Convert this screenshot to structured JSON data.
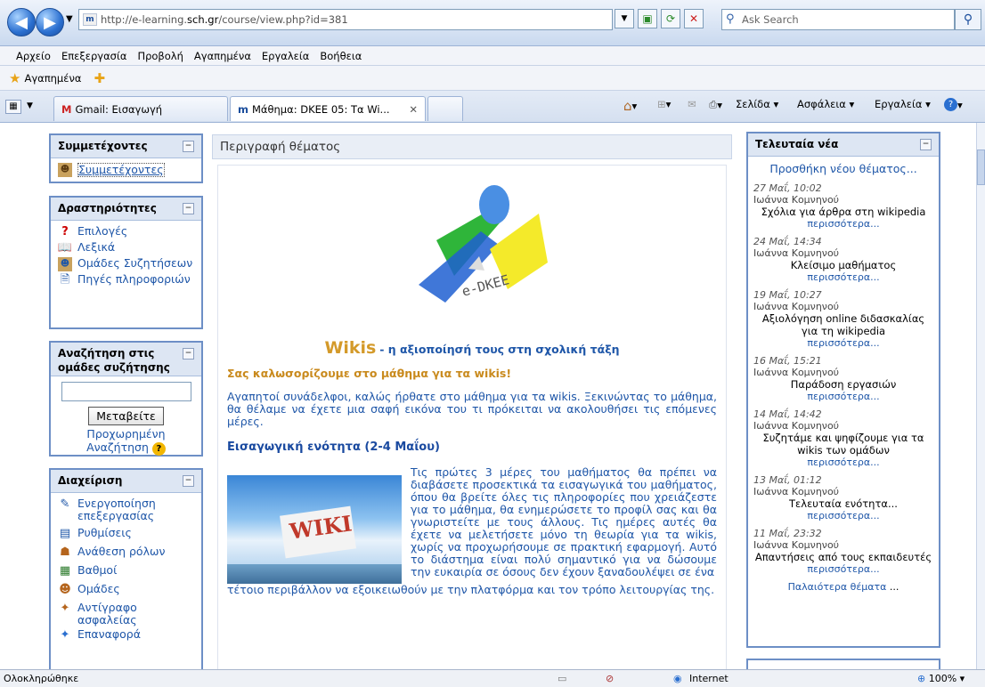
{
  "browser": {
    "url_prefix": "http://e-learning.",
    "url_domain": "sch.gr",
    "url_path": "/course/view.php?id=381",
    "search_placeholder": "Ask Search",
    "favicon_text": "m"
  },
  "menu": [
    "Αρχείο",
    "Επεξεργασία",
    "Προβολή",
    "Αγαπημένα",
    "Εργαλεία",
    "Βοήθεια"
  ],
  "favorites_label": "Αγαπημένα",
  "tabs": [
    {
      "label": "Gmail: Εισαγωγή"
    },
    {
      "label": "Μάθημα: DKEE 05: Τα Wi..."
    }
  ],
  "commands": {
    "page": "Σελίδα",
    "safety": "Ασφάλεια",
    "tools": "Εργαλεία"
  },
  "participants": {
    "title": "Συμμετέχοντες",
    "link": "Συμμετέχοντες"
  },
  "activities": {
    "title": "Δραστηριότητες",
    "items": [
      "Επιλογές",
      "Λεξικά",
      "Ομάδες Συζητήσεων",
      "Πηγές πληροφοριών"
    ]
  },
  "forum_search": {
    "title": "Αναζήτηση στις ομάδες συζήτησης",
    "button": "Μεταβείτε",
    "advanced": "Προχωρημένη Αναζήτηση"
  },
  "admin": {
    "title": "Διαχείριση",
    "items": [
      "Ενεργοποίηση επεξεργασίας",
      "Ρυθμίσεις",
      "Ανάθεση ρόλων",
      "Βαθμοί",
      "Ομάδες",
      "Αντίγραφο ασφαλείας",
      "Επαναφορά"
    ]
  },
  "main": {
    "header": "Περιγραφή θέματος",
    "logo_text": "e-DKEE",
    "wikis_word": "Wikis",
    "wikis_subtitle": "- η αξιοποίησή τους στη σχολική τάξη",
    "welcome": "Σας καλωσορίζουμε στο μάθημα για τα wikis!",
    "intro": "Αγαπητοί συνάδελφοι, καλώς ήρθατε στο μάθημα για τα wikis. Ξεκινώντας το μάθημα, θα θέλαμε να έχετε μια σαφή εικόνα του τι πρόκειται να ακολουθήσει τις επόμενες μέρες.",
    "section": "Εισαγωγική ενότητα (2-4 Μαΐου)",
    "wiki_image_text": "WIKI",
    "paragraph": "Τις πρώτες 3 μέρες του μαθήματος θα πρέπει να διαβάσετε προσεκτικά τα εισαγωγικά του μαθήματος, όπου θα βρείτε όλες τις πληροφορίες που χρειάζεστε για το μάθημα, θα ενημερώσετε το προφίλ σας και θα γνωριστείτε με τους άλλους. Τις ημέρες αυτές θα έχετε να μελετήσετε μόνο τη θεωρία για τα wikis, χωρίς να προχωρήσουμε σε πρακτική εφαρμογή. Αυτό το διάστημα είναι πολύ σημαντικό για να δώσουμε την ευκαιρία σε όσους δεν έχουν ξαναδουλέψει σε ένα",
    "paragraph_cont": "τέτοιο περιβάλλον να εξοικειωθούν με την πλατφόρμα και τον τρόπο λειτουργίας της."
  },
  "news": {
    "title": "Τελευταία νέα",
    "add_topic": "Προσθήκη νέου θέματος...",
    "more_label": "περισσότερα...",
    "older": "Παλαιότερα θέματα",
    "older_suffix": "...",
    "entries": [
      {
        "date": "27 Μαΐ, 10:02",
        "author": "Ιωάννα Κομνηνού",
        "subject": "Σχόλια για άρθρα στη wikipedia"
      },
      {
        "date": "24 Μαΐ, 14:34",
        "author": "Ιωάννα Κομνηνού",
        "subject": "Κλείσιμο μαθήματος"
      },
      {
        "date": "19 Μαΐ, 10:27",
        "author": "Ιωάννα Κομνηνού",
        "subject": "Αξιολόγηση online διδασκαλίας για τη wikipedia"
      },
      {
        "date": "16 Μαΐ, 15:21",
        "author": "Ιωάννα Κομνηνού",
        "subject": "Παράδοση εργασιών"
      },
      {
        "date": "14 Μαΐ, 14:42",
        "author": "Ιωάννα Κομνηνού",
        "subject": "Συζητάμε και ψηφίζουμε για τα wikis των ομάδων"
      },
      {
        "date": "13 Μαΐ, 01:12",
        "author": "Ιωάννα Κομνηνού",
        "subject": "Τελευταία ενότητα..."
      },
      {
        "date": "11 Μαΐ, 23:32",
        "author": "Ιωάννα Κομνηνού",
        "subject": "Απαντήσεις από τους εκπαιδευτές"
      }
    ]
  },
  "status": {
    "left": "Ολοκληρώθηκε",
    "zone": "Internet",
    "zoom": "100%"
  },
  "colors": {
    "accent": "#1e56a8",
    "wikis": "#d49a2a",
    "welcome": "#c98a1d",
    "section": "#1a4aa0"
  }
}
